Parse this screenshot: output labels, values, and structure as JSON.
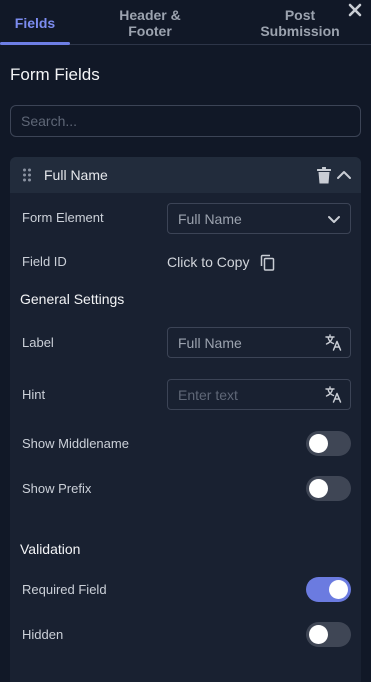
{
  "tabs": [
    {
      "label": "Fields",
      "active": true
    },
    {
      "label": "Header & Footer",
      "active": false
    },
    {
      "label": "Post Submission",
      "active": false
    }
  ],
  "panel": {
    "title": "Form Fields"
  },
  "search": {
    "placeholder": "Search...",
    "value": ""
  },
  "field_card": {
    "title": "Full Name",
    "form_element": {
      "label": "Form Element",
      "value": "Full Name"
    },
    "field_id": {
      "label": "Field ID",
      "action_text": "Click to Copy"
    },
    "general_settings": {
      "heading": "General Settings",
      "label_field": {
        "label": "Label",
        "value": "Full Name"
      },
      "hint_field": {
        "label": "Hint",
        "placeholder": "Enter text",
        "value": ""
      },
      "show_middlename": {
        "label": "Show Middlename",
        "on": false
      },
      "show_prefix": {
        "label": "Show Prefix",
        "on": false
      }
    },
    "validation": {
      "heading": "Validation",
      "required": {
        "label": "Required Field",
        "on": true
      },
      "hidden": {
        "label": "Hidden",
        "on": false
      }
    }
  },
  "colors": {
    "background": "#111827",
    "card": "#192131",
    "accent": "#6b7be0",
    "active_tab": "#7c8cf0"
  },
  "icons": [
    "close-icon",
    "drag-handle-icon",
    "trash-icon",
    "chevron-up-icon",
    "chevron-down-icon",
    "copy-icon",
    "translate-icon"
  ]
}
